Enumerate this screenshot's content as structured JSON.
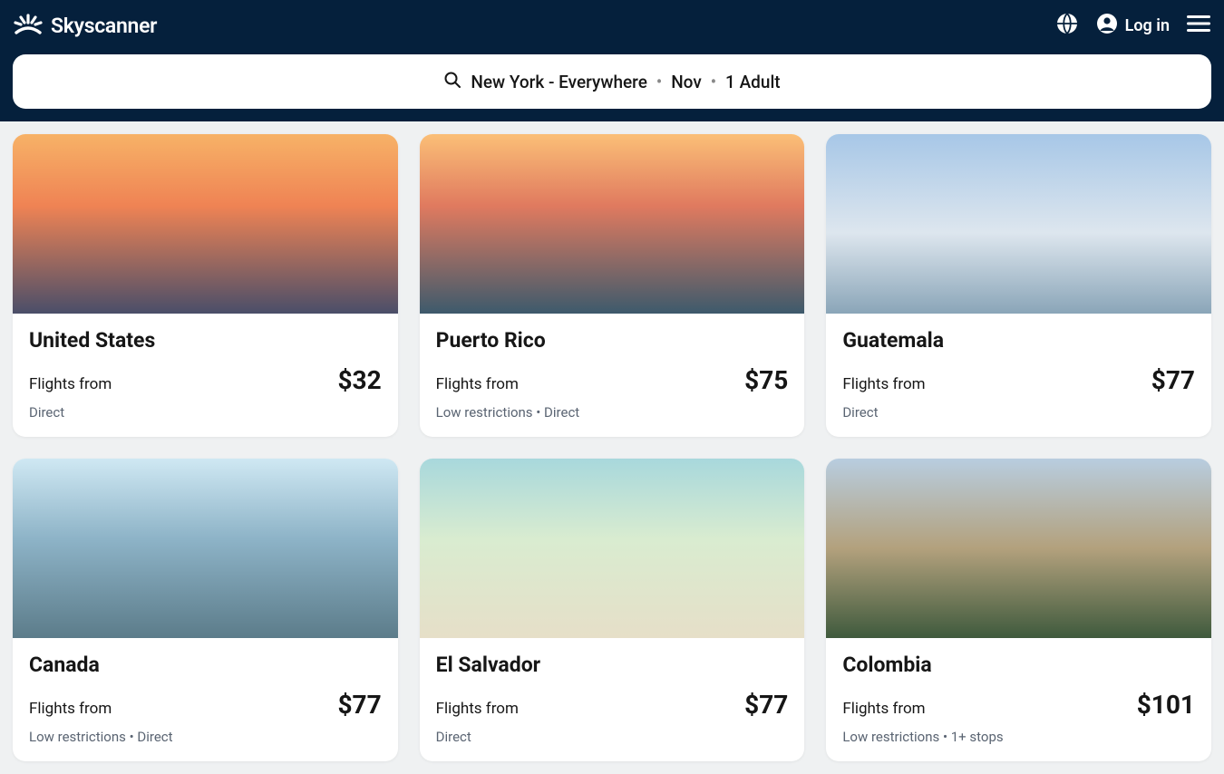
{
  "brand": "Skyscanner",
  "header": {
    "login_label": "Log in"
  },
  "search": {
    "query": "New York - Everywhere",
    "month": "Nov",
    "pax": "1 Adult"
  },
  "cards": [
    {
      "title": "United States",
      "flights_from_label": "Flights from",
      "price": "$32",
      "meta": "Direct"
    },
    {
      "title": "Puerto Rico",
      "flights_from_label": "Flights from",
      "price": "$75",
      "meta": "Low restrictions • Direct"
    },
    {
      "title": "Guatemala",
      "flights_from_label": "Flights from",
      "price": "$77",
      "meta": "Direct"
    },
    {
      "title": "Canada",
      "flights_from_label": "Flights from",
      "price": "$77",
      "meta": "Low restrictions • Direct"
    },
    {
      "title": "El Salvador",
      "flights_from_label": "Flights from",
      "price": "$77",
      "meta": "Direct"
    },
    {
      "title": "Colombia",
      "flights_from_label": "Flights from",
      "price": "$101",
      "meta": "Low restrictions • 1+ stops"
    }
  ]
}
